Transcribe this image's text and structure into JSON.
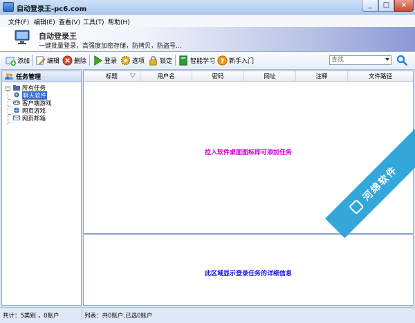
{
  "window": {
    "title": "自动登录王-pc6.com",
    "min": "_",
    "max": "□",
    "close": "×"
  },
  "menu": [
    "文件(F)",
    "编辑(E)",
    "查看(V)",
    "工具(T)",
    "帮助(H)"
  ],
  "banner": {
    "title": "自动登录王",
    "slogan": "一键批量登录，高强度加密存储，防拷贝，防盗号..."
  },
  "toolbar": {
    "add": "添加",
    "edit": "编辑",
    "delete": "删除",
    "login": "登录",
    "options": "选项",
    "lock": "锁定",
    "smart_learn": "智能学习",
    "beginner": "新手入门",
    "search_placeholder": "查找"
  },
  "left_panel": {
    "title": "任务管理",
    "tree_root": "所有任务",
    "tree_items": [
      "聊天软件",
      "客户端游戏",
      "网页游戏",
      "网页邮箱"
    ]
  },
  "grid": {
    "columns": [
      "标题",
      "用户名",
      "密码",
      "网址",
      "注释",
      "文件路径"
    ],
    "hint": "拉入软件桌面图标即可添加任务"
  },
  "detail": {
    "hint": "此区域显示登录任务的详细信息"
  },
  "status": {
    "left": "共计：5类别 ，0账户",
    "right": "列表：共0账户,已选0账户"
  },
  "watermark": {
    "text": "河绵软件"
  },
  "colors": {
    "grid_hint": "#d100d1",
    "detail_hint": "#1a1ae0",
    "selection": "#3169c6",
    "watermark": "#2aa3d9"
  }
}
